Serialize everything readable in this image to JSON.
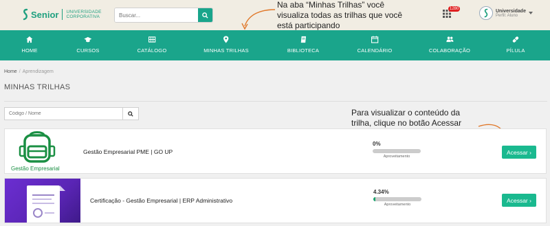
{
  "header": {
    "logo_name": "Senior",
    "logo_sub_line1": "UNIVERSIDADE",
    "logo_sub_line2": "CORPORATIVA",
    "search_placeholder": "Buscar...",
    "notification_count": "1280",
    "user_name": "Universidade",
    "user_role": "Perfil: Aluno"
  },
  "callouts": {
    "tab_note": "Na aba “Minhas Trilhas” você visualiza todas as trilhas que você está participando",
    "access_note": "Para visualizar o conteúdo da trilha, clique no botão Acessar"
  },
  "nav": {
    "items": [
      {
        "label": "HOME",
        "icon": "home-icon"
      },
      {
        "label": "CURSOS",
        "icon": "graduation-cap-icon"
      },
      {
        "label": "CATÁLOGO",
        "icon": "catalog-grid-icon"
      },
      {
        "label": "MINHAS TRILHAS",
        "icon": "map-pin-icon"
      },
      {
        "label": "BIBLIOTECA",
        "icon": "book-icon"
      },
      {
        "label": "CALENDÁRIO",
        "icon": "calendar-icon"
      },
      {
        "label": "COLABORAÇÃO",
        "icon": "users-icon"
      },
      {
        "label": "PÍLULA",
        "icon": "pill-icon"
      }
    ]
  },
  "breadcrumb": {
    "home": "Home",
    "separator": "/",
    "current": "Aprendizagem"
  },
  "page_title": "MINHAS TRILHAS",
  "filter": {
    "placeholder": "Código / Nome"
  },
  "trails": [
    {
      "title": "Gestão Empresarial PME | GO UP",
      "progress_text": "0%",
      "progress_value": 0,
      "progress_label": "Aproveitamento",
      "button_label": "Acessar ›",
      "thumbnail_label": "Gestão Empresarial"
    },
    {
      "title": "Certificação - Gestão Empresarial | ERP Administrativo",
      "progress_text": "4.34%",
      "progress_value": 4.34,
      "progress_label": "Aproveitamento",
      "button_label": "Acessar ›"
    }
  ],
  "colors": {
    "brand": "#1aa58b",
    "button": "#1ab98f",
    "header_bg": "#f1ede3",
    "annotation_arrow": "#e0782a"
  }
}
